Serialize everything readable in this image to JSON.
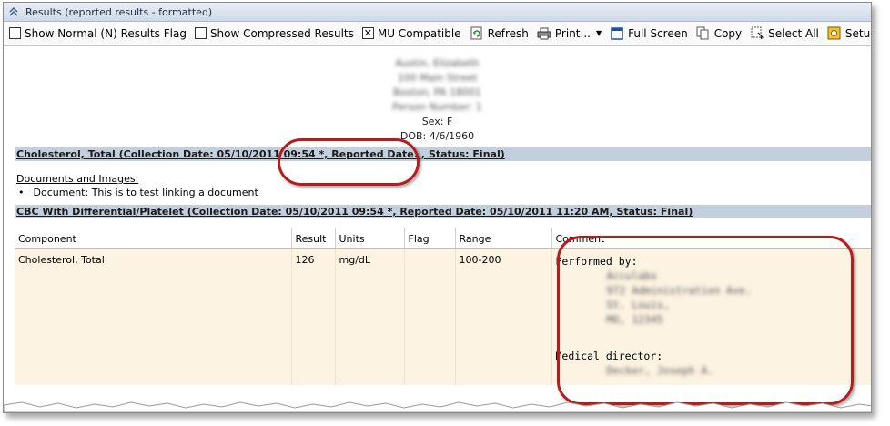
{
  "window": {
    "title": "Results (reported results - formatted)"
  },
  "toolbar": {
    "show_normal": {
      "label": "Show Normal (N) Results Flag",
      "checked": false
    },
    "show_compressed": {
      "label": "Show Compressed Results",
      "checked": false
    },
    "mu_compatible": {
      "label": "MU Compatible",
      "checked": true
    },
    "refresh": "Refresh",
    "print": "Print...",
    "full_screen": "Full Screen",
    "copy": "Copy",
    "select_all": "Select All",
    "setup": "Setup..."
  },
  "patient": {
    "name": "Austin, Elizabeth",
    "address1": "100 Main Street",
    "address2": "Boston, PA 18001",
    "person_number": "Person Number: 1",
    "sex": "Sex: F",
    "dob": "DOB: 4/6/1960"
  },
  "sections": {
    "cholesterol_header": "Cholesterol, Total (Collection Date: 05/10/2011 09:54 *, Reported Date: , Status: Final)",
    "documents_header": "Documents and Images:",
    "document_item": "Document: This is to test linking a document",
    "cbc_header": "CBC With Differential/Platelet (Collection Date: 05/10/2011 09:54 *, Reported Date: 05/10/2011 11:20 AM, Status: Final)"
  },
  "table": {
    "columns": [
      "Component",
      "Result",
      "Units",
      "Flag",
      "Range",
      "Comment"
    ],
    "rows": [
      {
        "component": "Cholesterol, Total",
        "result": "126",
        "units": "mg/dL",
        "flag": "",
        "range": "100-200",
        "comment": {
          "performed_by_label": "Performed by:",
          "lab_name": "Acculabs",
          "lab_addr1": "972 Administration Ave.",
          "lab_addr2": "St. Louis,",
          "lab_addr3": "MO, 12345",
          "director_label": "Medical director:",
          "director_name": "Decker, Joseph A."
        }
      }
    ]
  },
  "colors": {
    "accent": "#c3cfdc",
    "row_bg": "#fdf3e3",
    "callout": "#b71c1c"
  }
}
